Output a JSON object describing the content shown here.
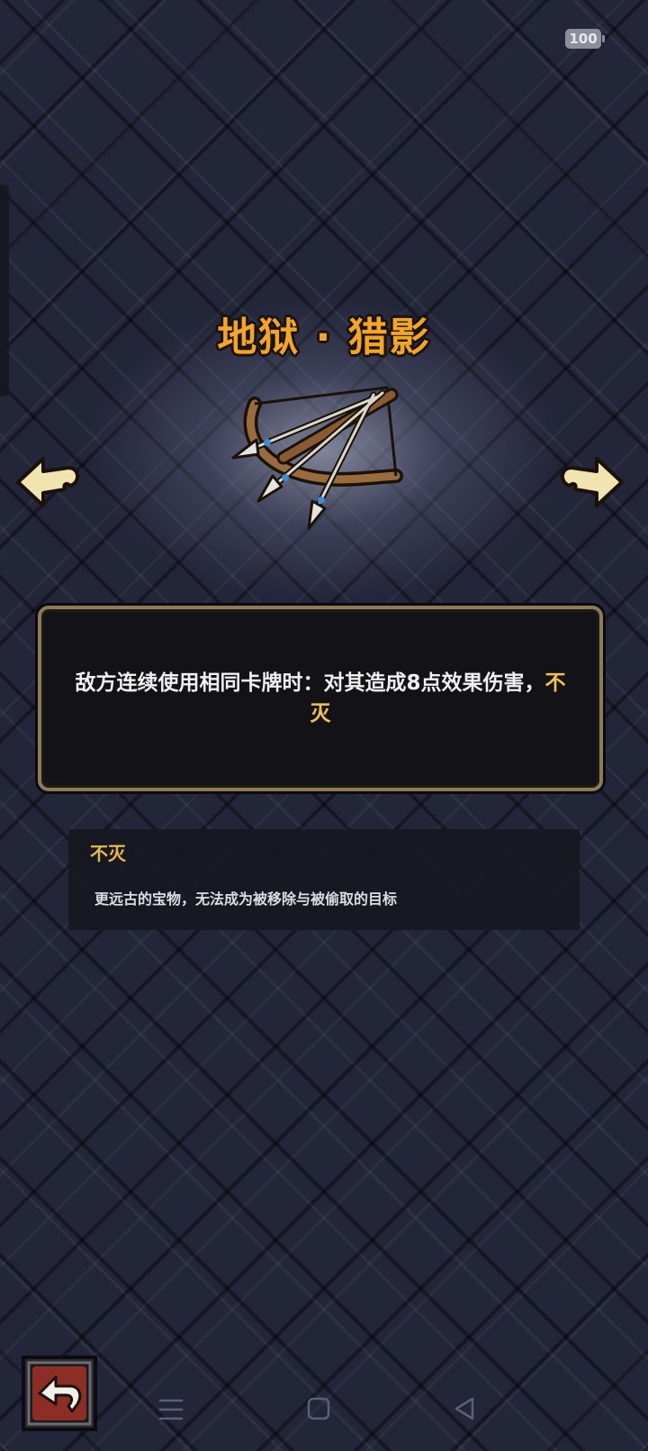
{
  "status": {
    "battery": "100"
  },
  "relic": {
    "name": "地狱 · 猎影",
    "image": "crossbow-relic-icon"
  },
  "navigation": {
    "prev_icon": "arrow-left-icon",
    "next_icon": "arrow-right-icon"
  },
  "description": {
    "text": "敌方连续使用相同卡牌时：对其造成8点效果伤害，",
    "keyword": "不灭"
  },
  "keyword_info": {
    "title": "不灭",
    "text": "更远古的宝物，无法成为被移除与被偷取的目标"
  },
  "footer": {
    "back_icon": "return-arrow-icon"
  },
  "system_nav": {
    "menu_icon": "menu-lines-icon",
    "home_icon": "home-square-icon",
    "back_icon": "back-triangle-icon"
  },
  "colors": {
    "title": "#f2a624",
    "keyword": "#f0c34a",
    "background": "#232539",
    "frame": "#8c7a5a"
  }
}
